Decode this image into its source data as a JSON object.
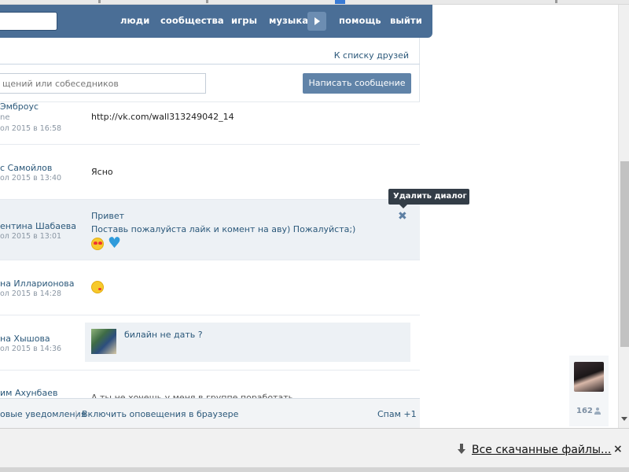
{
  "nav": {
    "items": [
      "люди",
      "сообщества",
      "игры",
      "музыка",
      "помощь",
      "выйти"
    ]
  },
  "panel": {
    "friends_link": "К списку друзей",
    "search_placeholder": "щений или собеседников",
    "write_button": "Написать сообщение"
  },
  "dialogs": [
    {
      "name": "Эмброус",
      "sub": "ne",
      "date": "ол 2015 в 16:58",
      "text": "http://vk.com/wall313249042_14"
    },
    {
      "name": "с Самойлов",
      "date": "ол 2015 в 13:40",
      "text": "Ясно"
    },
    {
      "name": "ентина Шабаева",
      "date": "ол 2015 в 13:01",
      "text_line1": "Привет",
      "text_line2": "Поставь пожалуйста лайк и комент на аву) Пожалуйста;)",
      "emojis": [
        "heart-eyes",
        "blue-heart"
      ]
    },
    {
      "name": "на Илларионова",
      "date": "ол 2015 в 14:28",
      "emojis": [
        "kiss"
      ]
    },
    {
      "name": "на Хышова",
      "date": "ол 2015 в 14:36",
      "text": "билайн не дать ?"
    },
    {
      "name": "им Ахунбаев",
      "text": "А ты не хочешь у меня в группе поработать"
    }
  ],
  "tooltip": "Удалить диалог",
  "footer": {
    "notifications": "овые уведомления",
    "separator": "|",
    "browser_alerts": "Включить оповещения в браузере",
    "spam": "Спам +1"
  },
  "right_widget": {
    "count": "162"
  },
  "download_bar": {
    "link": "Все скачанные файлы...",
    "close": "×"
  },
  "colors": {
    "header": "#4a6e96",
    "link": "#2b587a",
    "button": "#6083a8",
    "highlight": "#edf1f5"
  }
}
